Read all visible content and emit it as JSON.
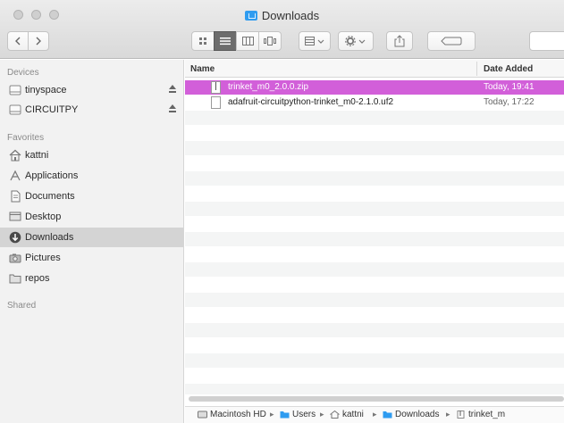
{
  "window": {
    "title": "Downloads"
  },
  "sidebar": {
    "devices_header": "Devices",
    "devices": [
      {
        "label": "tinyspace",
        "icon": "disk-icon"
      },
      {
        "label": "CIRCUITPY",
        "icon": "disk-icon"
      }
    ],
    "favorites_header": "Favorites",
    "favorites": [
      {
        "label": "kattni",
        "icon": "home-icon"
      },
      {
        "label": "Applications",
        "icon": "applications-icon"
      },
      {
        "label": "Documents",
        "icon": "documents-icon"
      },
      {
        "label": "Desktop",
        "icon": "desktop-icon"
      },
      {
        "label": "Downloads",
        "icon": "downloads-icon",
        "selected": true
      },
      {
        "label": "Pictures",
        "icon": "camera-icon"
      },
      {
        "label": "repos",
        "icon": "folder-icon"
      }
    ],
    "shared_header": "Shared"
  },
  "columns": {
    "name": "Name",
    "date_added": "Date Added"
  },
  "files": [
    {
      "name": "trinket_m0_2.0.0.zip",
      "date": "Today, 19:41",
      "selected": true,
      "icon": "zip-icon"
    },
    {
      "name": "adafruit-circuitpython-trinket_m0-2.1.0.uf2",
      "date": "Today, 17:22",
      "selected": false,
      "icon": "document-icon"
    }
  ],
  "pathbar": {
    "items": [
      "Macintosh HD",
      "Users",
      "kattni",
      "Downloads",
      "trinket_m"
    ]
  },
  "colors": {
    "selection": "#d25fd9",
    "folder_blue": "#2f9cf0"
  }
}
